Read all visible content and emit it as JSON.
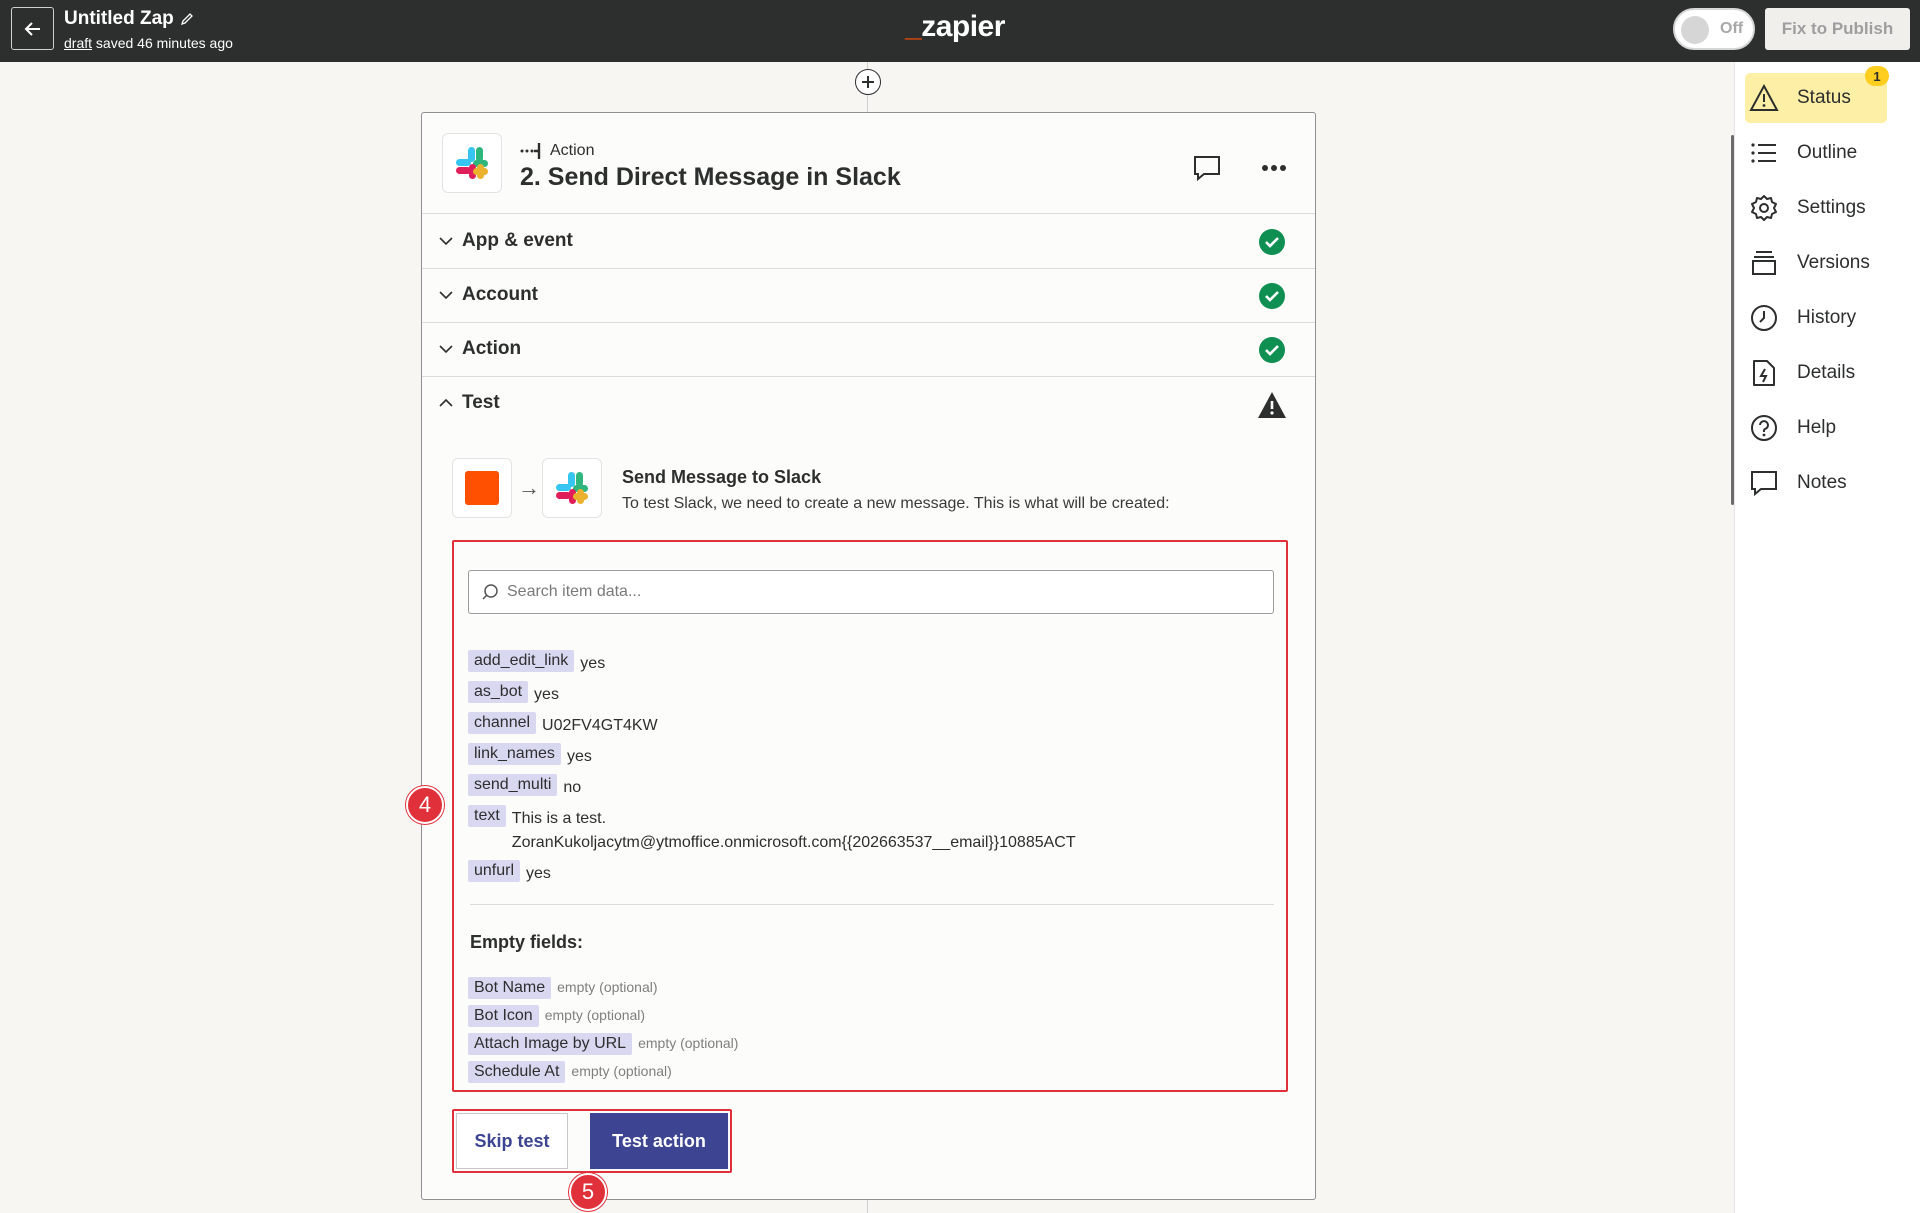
{
  "header": {
    "zap_title": "Untitled Zap",
    "draft_link": "draft",
    "saved_text": "saved 46 minutes ago",
    "logo_text": "zapier",
    "toggle_label": "Off",
    "publish_label": "Fix to Publish"
  },
  "sidebar": {
    "status_badge": "1",
    "items": [
      {
        "label": "Status",
        "icon": "warning-icon"
      },
      {
        "label": "Outline",
        "icon": "list-icon"
      },
      {
        "label": "Settings",
        "icon": "gear-icon"
      },
      {
        "label": "Versions",
        "icon": "versions-icon"
      },
      {
        "label": "History",
        "icon": "clock-icon"
      },
      {
        "label": "Details",
        "icon": "file-bolt-icon"
      },
      {
        "label": "Help",
        "icon": "question-icon"
      },
      {
        "label": "Notes",
        "icon": "note-icon"
      }
    ]
  },
  "step": {
    "kind": "Action",
    "title": "2. Send Direct Message in Slack",
    "sections": [
      {
        "label": "App & event",
        "status": "complete"
      },
      {
        "label": "Account",
        "status": "complete"
      },
      {
        "label": "Action",
        "status": "complete"
      },
      {
        "label": "Test",
        "status": "warning"
      }
    ]
  },
  "test": {
    "title": "Send Message to Slack",
    "description": "To test Slack, we need to create a new message. This is what will be created:",
    "search_placeholder": "Search item data...",
    "fields": [
      {
        "key": "add_edit_link",
        "value": "yes"
      },
      {
        "key": "as_bot",
        "value": "yes"
      },
      {
        "key": "channel",
        "value": "U02FV4GT4KW"
      },
      {
        "key": "link_names",
        "value": "yes"
      },
      {
        "key": "send_multi",
        "value": "no"
      },
      {
        "key": "text",
        "value": "This is a test.",
        "value_line2": "ZoranKukoljacytm@ytmoffice.onmicrosoft.com{{202663537__email}}10885ACT"
      },
      {
        "key": "unfurl",
        "value": "yes"
      }
    ],
    "empty_heading": "Empty fields:",
    "empty_fields": [
      {
        "key": "Bot Name",
        "value": "empty (optional)"
      },
      {
        "key": "Bot Icon",
        "value": "empty (optional)"
      },
      {
        "key": "Attach Image by URL",
        "value": "empty (optional)"
      },
      {
        "key": "Schedule At",
        "value": "empty (optional)"
      }
    ],
    "skip_label": "Skip test",
    "test_label": "Test action"
  },
  "markers": {
    "m4": "4",
    "m5": "5"
  },
  "colors": {
    "accent": "#3d4592",
    "brand": "#ff4f00",
    "highlight": "#e0303a",
    "success": "#0f8f52",
    "status_bg": "#fdf0a6"
  }
}
